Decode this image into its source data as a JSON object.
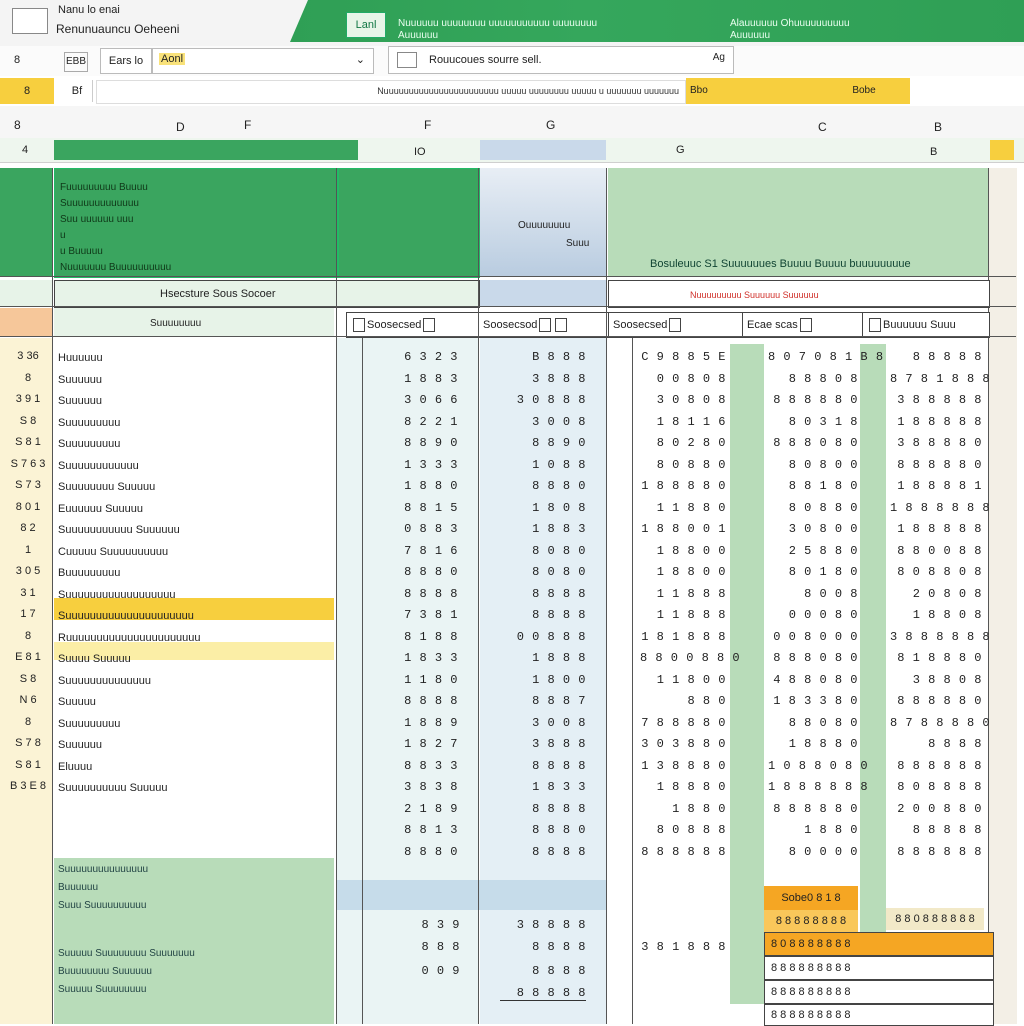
{
  "app": {
    "title_line1": "Nanu lo enai",
    "title_line2": "Renunuauncu Oeheeni",
    "green_badge": "Lanl",
    "green_text1": "Nuuuuuu uuuuuuuu uuuuuuuuuuu uuuuuuuu",
    "green_text2": "Auuuuuu",
    "green_text3": "Alauuuuuu Ohuuuuuuuuuu",
    "green_text4": "Auuuuuu"
  },
  "toolbar": {
    "left_label": "8",
    "box1": "EBB",
    "font_label": "Ears lo",
    "font_box": "Aonl",
    "search_text": "Rouucoues sourre sell.",
    "dropdown_mark": "Ag"
  },
  "formula": {
    "cell_ref": "8",
    "fx": "Bf",
    "formula_text": "Nuuuuuuuuuuuuuuuuuuuuuuu uuuuu uuuuuuuu uuuuu u uuuuuuu uuuuuuu",
    "yellow_a": "Bbo",
    "yellow_b": "Bobe"
  },
  "columns": {
    "headers": [
      "8",
      "D",
      "F",
      "F",
      "G",
      "C",
      "B"
    ],
    "sub": [
      "4",
      "IO",
      "G",
      "B"
    ]
  },
  "header_block": {
    "left_lines": [
      "Fuuuuuuuuu Buuuu",
      "Suuuuuuuuuuuuu",
      "Suu uuuuuu uuu",
      "u",
      "u Buuuuu",
      "Nuuuuuuu Buuuuuuuuuu"
    ],
    "blue_a": "Ouuuuuuuu",
    "blue_b": "Suuu",
    "green_right": "Bosuleuuc S1 Suuuuuues Buuuu Buuuu buuuuuuuue"
  },
  "subheader": {
    "label": "Hsecsture Sous Socoer",
    "red_text": "Nuuuuuuuuu Suuuuuu Suuuuuu",
    "left_tag": "Suuuuuuuu",
    "col_headers": [
      "Soosecsed",
      "Soosecsod",
      "Soosecsed",
      "Ecae scas",
      "Buuuuuu Suuu"
    ]
  },
  "row_labels": [
    "Huuuuuu",
    "Suuuuuu",
    "Suuuuuu",
    "Suuuuuuuuu",
    "Suuuuuuuuu",
    "Suuuuuuuuuuuu",
    "Suuuuuuuu Suuuuu",
    "Euuuuuu Suuuuu",
    "Suuuuuuuuuuu Suuuuuu",
    "Cuuuuu Suuuuuuuuuu",
    "Buuuuuuuuu",
    "Suuuuuuuuuuuuuuuuuu",
    "Suuuuuuuuuuuuuuuuuuuuu",
    "Ruuuuuuuuuuuuuuuuuuuuuu",
    "Suuuu Suuuuu",
    "Suuuuuuuuuuuuuu",
    "Suuuuu",
    "Suuuuuuuuu",
    "Suuuuuu",
    "Eluuuu",
    "Suuuuuuuuuu Suuuuu"
  ],
  "row_numbers": [
    "3 36",
    "8",
    "3 9 1",
    "S 8",
    "S 8 1",
    "S 7 6 3",
    "S 7 3",
    "8 0 1",
    "8 2",
    "1",
    "3 0 5",
    "3 1",
    "1 7",
    "8",
    "E 8 1",
    "S 8",
    "N 6",
    "8",
    "S 7 8",
    "S 8 1",
    "B 3 E 8"
  ],
  "table_rows": [
    [
      "6 3 2 3",
      "B 8 8 8",
      "C 9 8 8 5 E",
      "8 0 7 0 8 1 B 8",
      "8 8 8 8 8"
    ],
    [
      "1 8 8 3",
      "3 8 8 8",
      "0 0 8 0 8",
      "8 8 8 0 8",
      "8 7 8 1 8 8 8"
    ],
    [
      "3 0 6 6",
      "3 0 8 8 8",
      "3 0 8 0 8",
      "8 8 8 8 8 0",
      "3 8 8 8 8 8"
    ],
    [
      "8 2 2 1",
      "3 0 0 8",
      "1 8 1 1 6",
      "8 0 3 1 8",
      "1 8 8 8 8 8"
    ],
    [
      "8 8 9 0",
      "8 8 9 0",
      "8 0 2 8 0",
      "8 8 8 0 8 0",
      "3 8 8 8 8 0"
    ],
    [
      "1 3 3 3",
      "1 0 8 8",
      "8 0 8 8 0",
      "8 0 8 0 0",
      "8 8 8 8 8 0"
    ],
    [
      "1 8 8 0",
      "8 8 8 0",
      "1 8 8 8 8 0",
      "8 8 1 8 0",
      "1 8 8 8 8 1"
    ],
    [
      "8 8 1 5",
      "1 8 0 8",
      "1 1 8 8 0",
      "8 0 8 8 0",
      "1 8 8 8 8 8 8"
    ],
    [
      "0 8 8 3",
      "1 8 8 3",
      "1 8 8 0 0 1",
      "3 0 8 0 0",
      "1 8 8 8 8 8"
    ],
    [
      "7 8 1 6",
      "8 0 8 0",
      "1 8 8 0 0",
      "2 5 8 8 0",
      "8 8 0 0 8 8"
    ],
    [
      "8 8 8 0",
      "8 0 8 0",
      "1 8 8 0 0",
      "8 0 1 8 0",
      "8 0 8 8 0 8"
    ],
    [
      "8 8 8 8",
      "8 8 8 8",
      "1 1 8 8 8",
      "8 0 0 8",
      "2 0 8 0 8"
    ],
    [
      "7 3 8 1",
      "8 8 8 8",
      "1 1 8 8 8",
      "0 0 0 8 0",
      "1 8 8 0 8"
    ],
    [
      "8 1 8 8",
      "0 0 8 8 8",
      "1 8 1 8 8 8",
      "0 0 8 0 0 0",
      "3 8 8 8 8 8 8"
    ],
    [
      "1 8 3 3",
      "1 8 8 8",
      "8 8 0 0 8 8 0",
      "8 8 8 0 8 0",
      "8 1 8 8 8 0"
    ],
    [
      "1 1 8 0",
      "1 8 0 0",
      "1 1 8 0 0",
      "4 8 8 0 8 0",
      "3 8 8 0 8"
    ],
    [
      "8 8 8 8",
      "8 8 8 7",
      "8 8 0",
      "1 8 3 3 8 0",
      "8 8 8 8 8 0"
    ],
    [
      "1 8 8 9",
      "3 0 0 8",
      "7 8 8 8 8 0",
      "8 8 0 8 0",
      "8 7 8 8 8 8 0"
    ],
    [
      "1 8 2 7",
      "3 8 8 8",
      "3 0 3 8 8 0",
      "1 8 8 8 0",
      "8 8 8 8"
    ],
    [
      "8 8 3 3",
      "8 8 8 8",
      "1 3 8 8 8 0",
      "1 0 8 8 0 8 0",
      "8 8 8 8 8 8"
    ],
    [
      "3 8 3 8",
      "1 8 3 3",
      "1 8 8 8 0",
      "1 8 8 8 8 8 8",
      "8 0 8 8 8 8"
    ],
    [
      "2 1 8 9",
      "8 8 8 8",
      "1 8 8 0",
      "8 8 8 8 8 0",
      "2 0 0 8 8 0"
    ],
    [
      "8 8 1 3",
      "8 8 8 0",
      "8 0 8 8 8",
      "1 8 8 0",
      "8 8 8 8 8"
    ],
    [
      "8 8 8 0",
      "8 8 8 8",
      "8 8 8 8 8 8",
      "8 0 0 0 0",
      "8 8 8 8 8 8"
    ]
  ],
  "footer": {
    "left_lines": [
      "Suuuuuuuuuuuuuuu",
      "Buuuuuu",
      "Suuu Suuuuuuuuuu",
      "Suuuuu Suuuuuuuu Suuuuuuu",
      "Buuuuuuuu Suuuuuu",
      "Suuuuu Suuuuuuuu"
    ],
    "sum_b": [
      "8 3 9",
      "8 8 8",
      "0 0 9"
    ],
    "sum_c": [
      "3 8 8 8 8",
      "8 8 8 8",
      "8 8 8 8",
      "8 8 8 8 8"
    ],
    "sum_e": [
      "3 8 1 8 8 8"
    ],
    "orange_1": "Sobe0 8 1 8",
    "orange_2": "8 8 8 8 8 8 8 8",
    "orange_3": "8 0 8 8 8 8 8 8 8",
    "orange_4": "8 8 0 8 8 8 8 8 8",
    "white_1": "8 8 8 8 8 8 8 8 8",
    "white_2": "8 8 8 8",
    "white_3": "8 8 8 8 8 8 8 8 8",
    "last_row": "8 8 8 8 8 8 8 8 8"
  },
  "colors": {
    "accent_green": "#3aa55f",
    "light_green": "#b8dcb9",
    "light_blue": "#c9d9ea",
    "yellow": "#f7cf3e",
    "orange": "#f5a623"
  }
}
